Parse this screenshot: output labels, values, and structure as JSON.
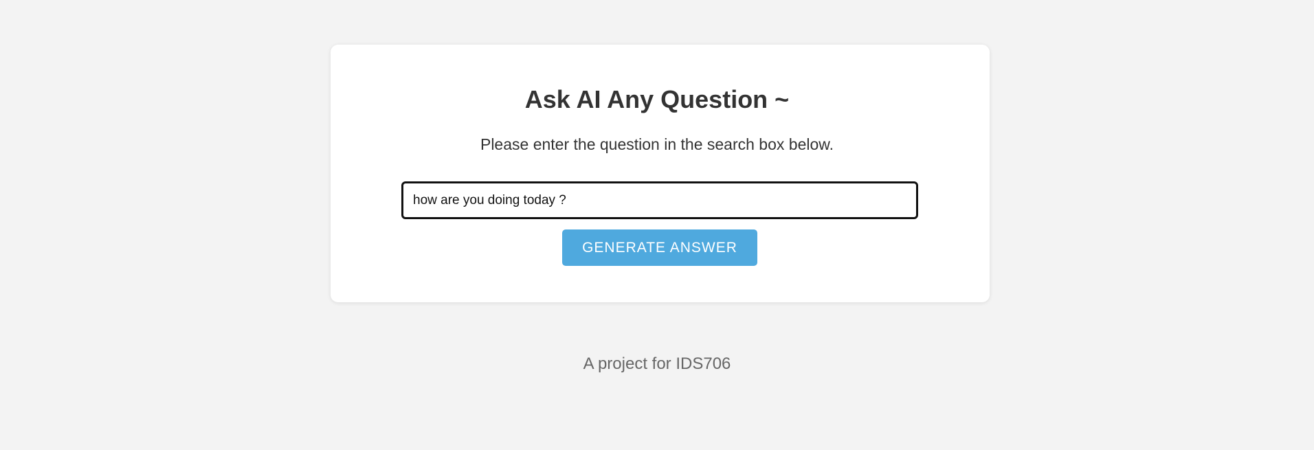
{
  "card": {
    "title": "Ask AI Any Question ~",
    "subtitle": "Please enter the question in the search box below.",
    "search": {
      "value": "how are you doing today ?",
      "placeholder": ""
    },
    "generate_button_label": "GENERATE ANSWER"
  },
  "footer": {
    "text": "A project for IDS706"
  },
  "colors": {
    "background": "#f3f3f3",
    "card": "#ffffff",
    "button": "#4fa9de",
    "text": "#333333",
    "footer_text": "#666666"
  }
}
